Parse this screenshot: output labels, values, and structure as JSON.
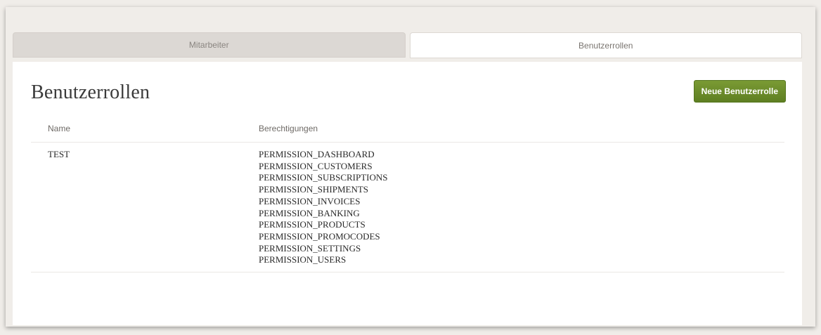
{
  "tabs": [
    {
      "label": "Mitarbeiter",
      "active": false
    },
    {
      "label": "Benutzerrollen",
      "active": true
    }
  ],
  "main": {
    "title": "Benutzerrollen",
    "new_button_label": "Neue Benutzerrolle",
    "button_color": "#6b8c2a",
    "table": {
      "columns": [
        "Name",
        "Berechtigungen"
      ],
      "rows": [
        {
          "name": "TEST",
          "permissions": [
            "PERMISSION_DASHBOARD",
            "PERMISSION_CUSTOMERS",
            "PERMISSION_SUBSCRIPTIONS",
            "PERMISSION_SHIPMENTS",
            "PERMISSION_INVOICES",
            "PERMISSION_BANKING",
            "PERMISSION_PRODUCTS",
            "PERMISSION_PROMOCODES",
            "PERMISSION_SETTINGS",
            "PERMISSION_USERS"
          ]
        }
      ]
    }
  }
}
